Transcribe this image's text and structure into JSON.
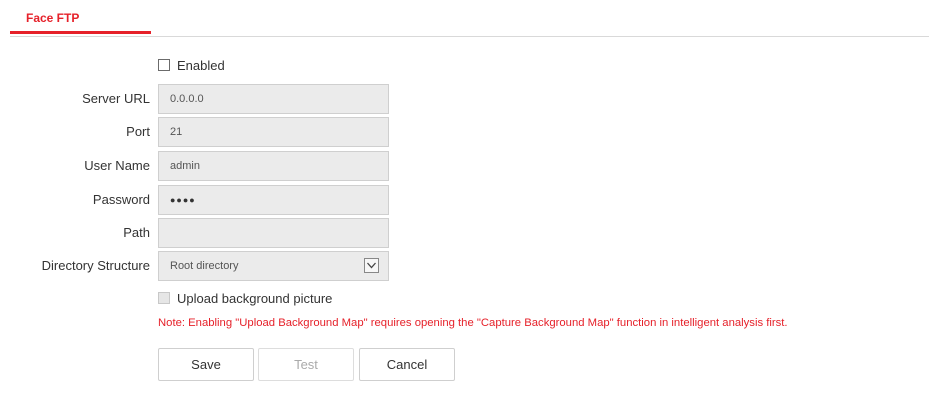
{
  "tabs": [
    {
      "label": "Face FTP",
      "active": true
    }
  ],
  "form": {
    "enabled": {
      "label": "Enabled",
      "checked": false
    },
    "server_url": {
      "label": "Server URL",
      "value": "0.0.0.0"
    },
    "port": {
      "label": "Port",
      "value": "21"
    },
    "user_name": {
      "label": "User Name",
      "value": "admin"
    },
    "password": {
      "label": "Password",
      "value": "●●●●"
    },
    "path": {
      "label": "Path",
      "value": ""
    },
    "directory_structure": {
      "label": "Directory Structure",
      "value": "Root directory"
    },
    "upload_background": {
      "label": "Upload background picture",
      "checked": false,
      "disabled": true
    },
    "note": "Note: Enabling \"Upload Background Map\" requires opening the \"Capture Background Map\" function in intelligent analysis first."
  },
  "buttons": {
    "save": "Save",
    "test": "Test",
    "cancel": "Cancel"
  },
  "colors": {
    "accent": "#e6212a",
    "field_bg": "#ebebeb",
    "border": "#cfcfcf"
  }
}
